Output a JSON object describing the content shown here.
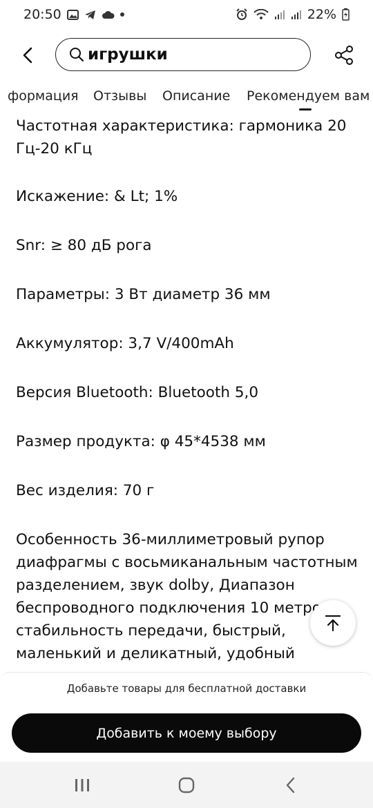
{
  "status_bar": {
    "time": "20:50",
    "battery": "22%",
    "icons_left": [
      "gallery-icon",
      "telegram-icon",
      "cloud-icon",
      "dot-icon"
    ],
    "icons_right": [
      "alarm-icon",
      "wifi-icon",
      "signal-icon",
      "signal-icon",
      "battery-icon"
    ]
  },
  "header": {
    "search_value": "игрушки"
  },
  "tabs": [
    {
      "label": "формация"
    },
    {
      "label": "Отзывы"
    },
    {
      "label": "Описание"
    },
    {
      "label": "Рекомендуем вам"
    }
  ],
  "content": {
    "paragraphs": [
      "Частотная характеристика: гармоника 20 Гц-20 кГц",
      "Искажение: & Lt; 1%",
      "Snr: ≥ 80 дБ рога",
      "Параметры: 3 Вт диаметр 36 мм",
      "Аккумулятор: 3,7 V/400mAh",
      "Версия Bluetooth: Bluetooth 5,0",
      "Размер продукта: φ 45*4538 мм",
      "Вес изделия: 70 г",
      "Особенность 36-миллиметровый рупор диафрагмы с восьмиканальным частотным разделением, звук dolby, Диапазон беспроводного подключения 10 метров, стабильность передачи, быстрый, маленький и деликатный, удобный"
    ]
  },
  "bottom_panel": {
    "free_delivery_text": "Добавьте товары для бесплатной доставки",
    "add_button_label": "Добавить к моему выбору"
  }
}
